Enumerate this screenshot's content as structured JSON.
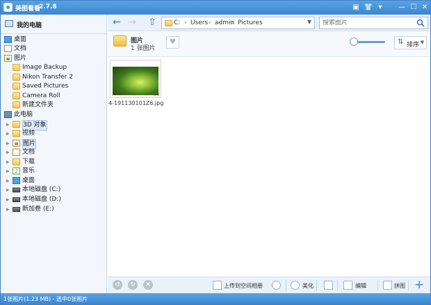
{
  "app": {
    "title": "美图看看",
    "version": "2.7.8"
  },
  "titlebar": {
    "msg_icon": "▣",
    "shirt_icon": "👕",
    "skin_icon": "▾",
    "minimize": "—",
    "maximize": "☐",
    "close": "✕"
  },
  "sidebar": {
    "header": "我的电脑",
    "items": [
      {
        "label": "桌面",
        "icon": "desktop-icon"
      },
      {
        "label": "文档",
        "icon": "document-icon"
      },
      {
        "label": "图片",
        "icon": "pictures-icon"
      },
      {
        "label": "Image Backup",
        "icon": "folder-icon"
      },
      {
        "label": "Nikon Transfer 2",
        "icon": "folder-icon"
      },
      {
        "label": "Saved Pictures",
        "icon": "folder-icon"
      },
      {
        "label": "Camera Roll",
        "icon": "folder-icon"
      },
      {
        "label": "新建文件夹",
        "icon": "folder-icon"
      },
      {
        "label": "此电脑",
        "icon": "computer-icon"
      },
      {
        "label": "3D 对象",
        "icon": "folder-icon"
      },
      {
        "label": "视频",
        "icon": "video-icon"
      },
      {
        "label": "图片",
        "icon": "pictures-icon"
      },
      {
        "label": "文档",
        "icon": "document-icon"
      },
      {
        "label": "下载",
        "icon": "download-icon"
      },
      {
        "label": "音乐",
        "icon": "music-icon"
      },
      {
        "label": "桌面",
        "icon": "desktop-icon"
      },
      {
        "label": "本地磁盘 (C:)",
        "icon": "drive-icon"
      },
      {
        "label": "本地磁盘 (D:)",
        "icon": "drive-icon"
      },
      {
        "label": "新加卷 (E:)",
        "icon": "drive-icon"
      }
    ]
  },
  "nav": {
    "back": "←",
    "forward": "→",
    "up": "⇧",
    "address": {
      "drive": "C:",
      "sep": "›",
      "segments": [
        "Users",
        "admin",
        "Pictures"
      ],
      "drop": "▼"
    },
    "search_placeholder": "搜索图片"
  },
  "folder": {
    "name": "图片",
    "count": "1 张图片",
    "fav": "♥",
    "sort_label": "排序",
    "sort_icon": "⇅",
    "sort_drop": "▼",
    "zoom_level": 0.05
  },
  "content": {
    "thumb_name": "4-191130101Z6.jpg",
    "thumb_tag": "jpg"
  },
  "bottombar": {
    "rotate_left": "↺",
    "rotate_right": "↻",
    "delete": "✕",
    "upload_label": "上传到空间相册",
    "beautify_label": "美化",
    "edit_label": "编辑",
    "puzzle_label": "拼图",
    "add": "+"
  },
  "status": "1张图片(1.23 MB) - 选中0张图片",
  "colors": {
    "accent": "#3b86d2",
    "sidebar_bg": "#f3f7fc"
  }
}
